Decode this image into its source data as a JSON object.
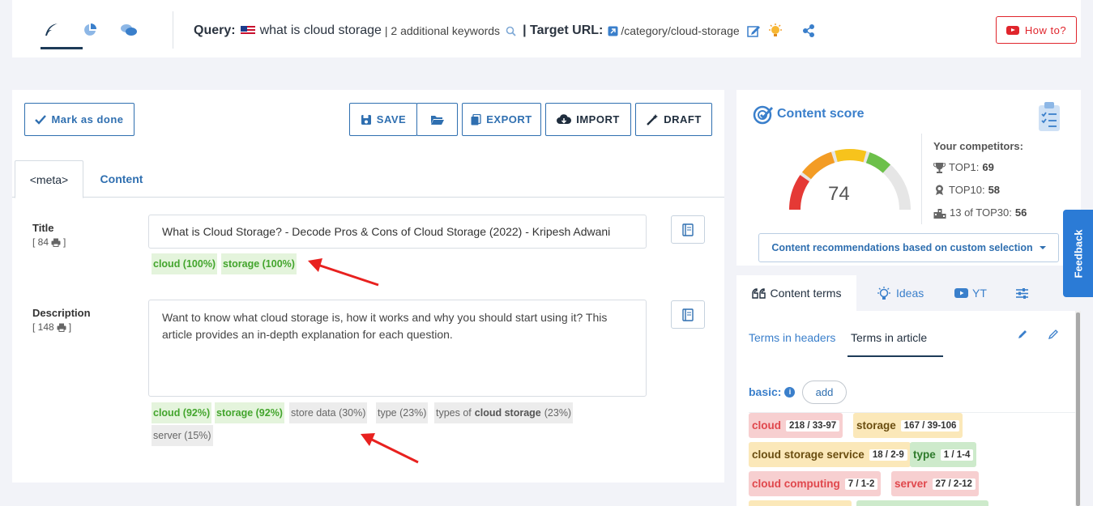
{
  "topbar": {
    "query_label": "Query:",
    "query_text": "what is cloud storage",
    "additional_keywords": "| 2 additional keywords",
    "target_url_label": "| Target URL:",
    "target_url": "/category/cloud-storage",
    "howto_label": "How to?"
  },
  "toolbar": {
    "mark_done": "Mark as done",
    "save": "SAVE",
    "export": "EXPORT",
    "import": "IMPORT",
    "draft": "DRAFT"
  },
  "tabs": {
    "meta": "<meta>",
    "content": "Content"
  },
  "title_field": {
    "label": "Title",
    "count": "[ 84",
    "count_end": "]",
    "value": "What is Cloud Storage? - Decode Pros & Cons of Cloud Storage (2022) - Kripesh Adwani",
    "keywords": [
      "cloud (100%)",
      "storage (100%)"
    ]
  },
  "description_field": {
    "label": "Description",
    "count": "[ 148",
    "count_end": "]",
    "value": "Want to know what cloud storage is, how it works and why you should start using it? This article provides an in-depth explanation for each question.",
    "keywords_green": [
      "cloud (92%)",
      "storage (92%)"
    ],
    "keywords_gray": [
      "store data (30%)",
      "type (23%)"
    ],
    "kw_types_prefix": "types of",
    "kw_types_bold": "cloud storage",
    "kw_types_suffix": "(23%)",
    "kw_server": "server (15%)"
  },
  "score": {
    "title": "Content score",
    "value": "74",
    "competitors_title": "Your competitors:",
    "top1_label": "TOP1:",
    "top1_value": "69",
    "top10_label": "TOP10:",
    "top10_value": "58",
    "top30_label": "13 of TOP30:",
    "top30_value": "56",
    "recommendations": "Content recommendations based on custom selection"
  },
  "terms": {
    "tab_content_terms": "Content terms",
    "tab_ideas": "Ideas",
    "tab_yt": "YT",
    "sub_headers": "Terms in headers",
    "sub_article": "Terms in article",
    "basic_label": "basic:",
    "add": "add",
    "chips": [
      {
        "term": "cloud",
        "count": "218 / 33-97"
      },
      {
        "term": "storage",
        "count": "167 / 39-106"
      },
      {
        "term": "cloud storage service",
        "count": "18 / 2-9"
      },
      {
        "term": "type",
        "count": "1 / 1-4"
      },
      {
        "term": "cloud computing",
        "count": "7 / 1-2"
      },
      {
        "term": "server",
        "count": "27 / 2-12"
      }
    ]
  },
  "feedback": "Feedback",
  "colors": {
    "accent_blue": "#2f6fb0",
    "link_blue": "#3a7fcb",
    "youtube_red": "#e0252c",
    "keyword_green": "#43a52d",
    "gauge_red": "#e53935",
    "gauge_orange": "#f39c25",
    "gauge_yellow": "#f7c31c",
    "gauge_green": "#6cc04a"
  }
}
